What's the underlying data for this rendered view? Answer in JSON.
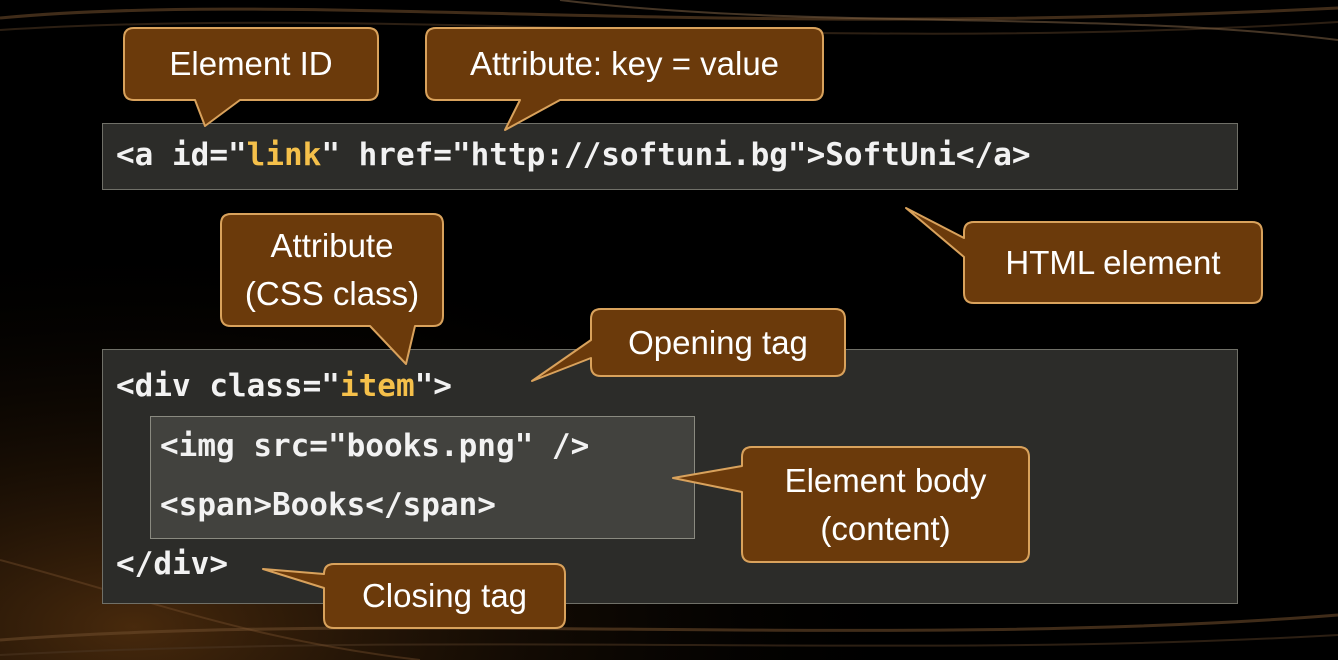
{
  "code_line_1": {
    "prefix": "<a id=\"",
    "highlight": "link",
    "suffix": "\" href=\"http://softuni.bg\">SoftUni</a>"
  },
  "code_line_2": {
    "prefix": "<div class=\"",
    "highlight": "item",
    "suffix": "\">"
  },
  "code_line_3": "<img src=\"books.png\" />",
  "code_line_4": "<span>Books</span>",
  "code_line_5": "</div>",
  "callouts": {
    "element_id": "Element ID",
    "attribute_key_value": "Attribute: key = value",
    "html_element": "HTML element",
    "attribute_css_class_line1": "Attribute",
    "attribute_css_class_line2": "(CSS class)",
    "opening_tag": "Opening tag",
    "element_body_line1": "Element body",
    "element_body_line2": "(content)",
    "closing_tag": "Closing tag"
  },
  "colors": {
    "callout_fill": "#6b3a0b",
    "callout_border": "#d9a25c",
    "code_highlight": "#f5c04a",
    "code_text": "#f2f2f2",
    "code_box": "#2c2c29",
    "inner_box": "#42423e"
  }
}
